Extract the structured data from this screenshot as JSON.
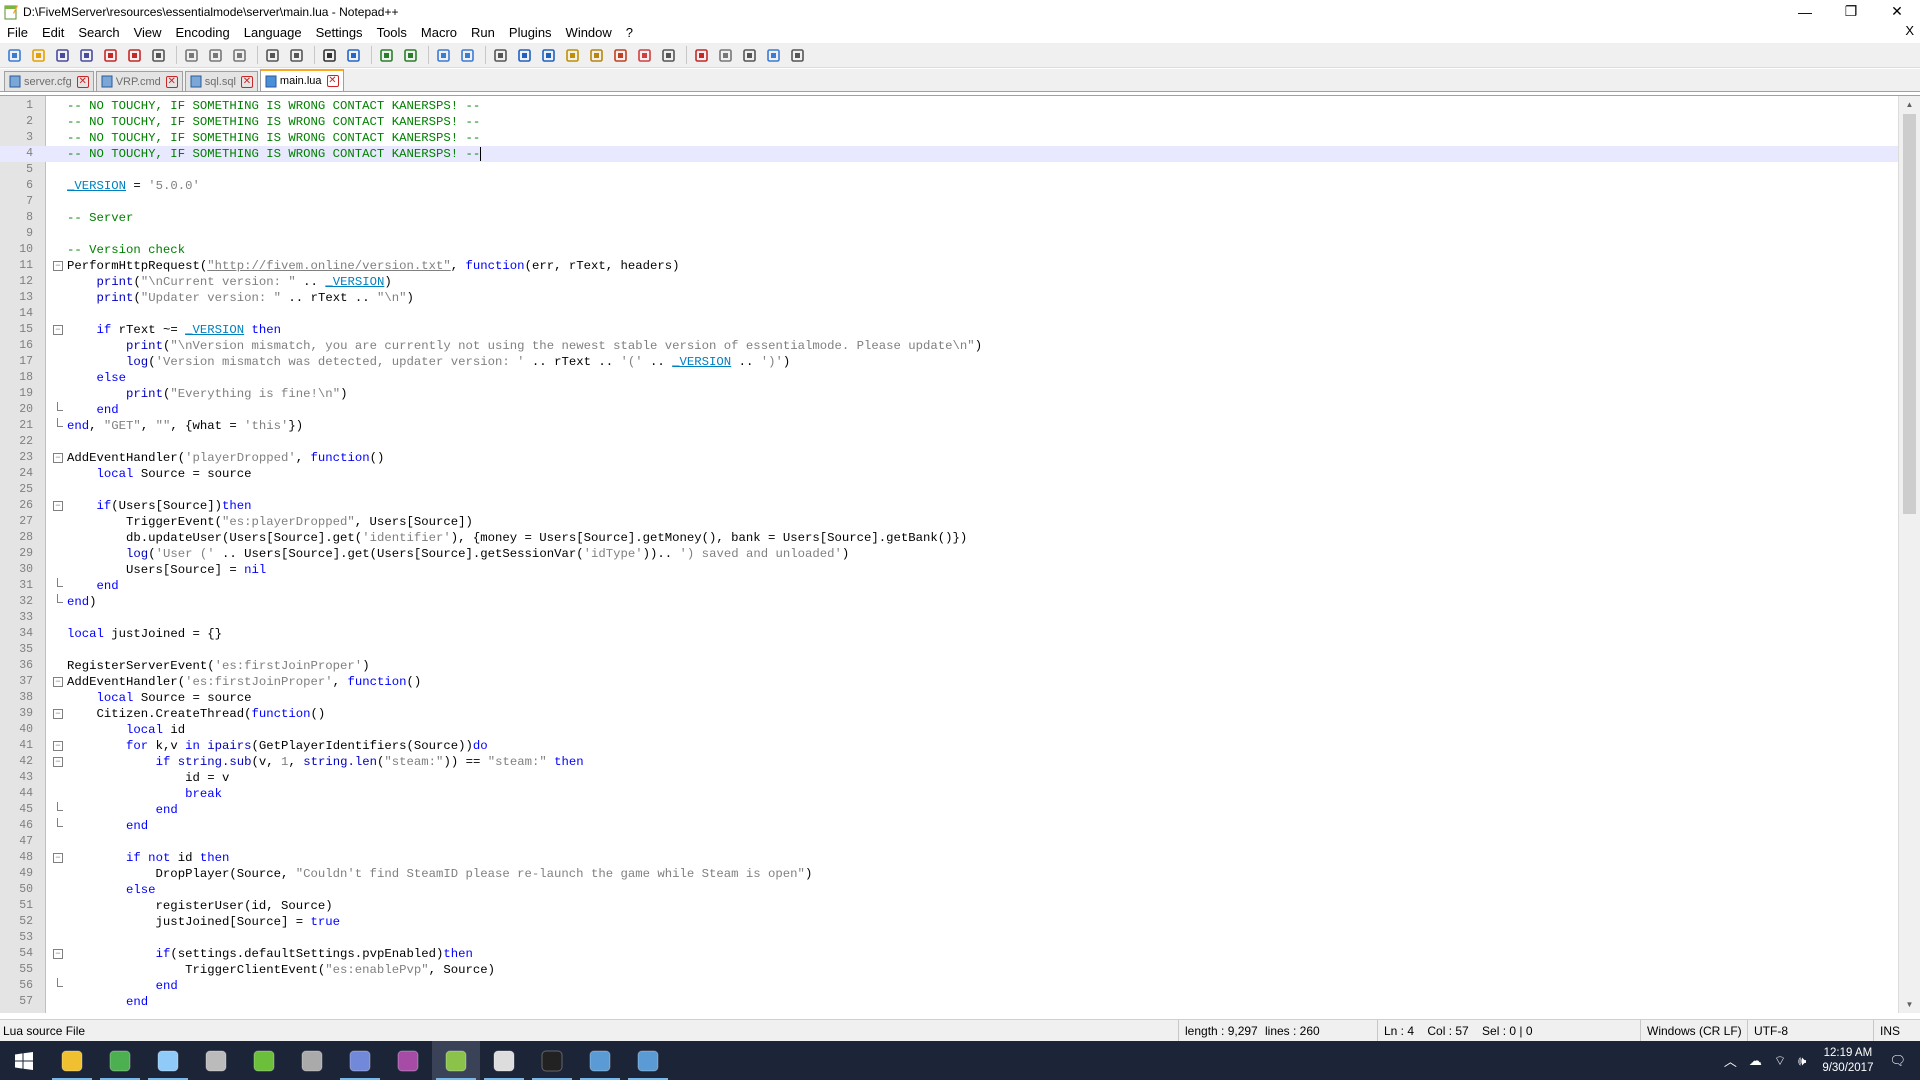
{
  "window": {
    "title": "D:\\FiveMServer\\resources\\essentialmode\\server\\main.lua - Notepad++",
    "minimize": "—",
    "maximize": "❐",
    "close": "✕"
  },
  "menu": {
    "items": [
      "File",
      "Edit",
      "Search",
      "View",
      "Encoding",
      "Language",
      "Settings",
      "Tools",
      "Macro",
      "Run",
      "Plugins",
      "Window",
      "?"
    ],
    "close_doc": "X"
  },
  "toolbar": {
    "icons": [
      "new-file-icon",
      "open-file-icon",
      "save-icon",
      "save-all-icon",
      "close-icon",
      "close-all-icon",
      "print-icon",
      "cut-icon",
      "copy-icon",
      "paste-icon",
      "undo-icon",
      "redo-icon",
      "find-icon",
      "replace-icon",
      "zoom-in-icon",
      "zoom-out-icon",
      "sync-vertical-icon",
      "sync-horizontal-icon",
      "word-wrap-icon",
      "show-all-chars-icon",
      "indent-guide-icon",
      "udl-icon",
      "doc-map-icon",
      "function-list-icon",
      "folder-as-workspace-icon",
      "monitoring-icon",
      "record-macro-icon",
      "stop-macro-icon",
      "play-macro-icon",
      "run-macro-multiple-icon",
      "save-macro-icon"
    ]
  },
  "tabs": [
    {
      "label": "server.cfg",
      "active": false
    },
    {
      "label": "VRP.cmd",
      "active": false
    },
    {
      "label": "sql.sql",
      "active": false
    },
    {
      "label": "main.lua",
      "active": true
    }
  ],
  "editor": {
    "current_line": 4,
    "lines": [
      {
        "n": "1",
        "fold": "",
        "html": "<span class='cm'>-- NO TOUCHY, IF SOMETHING IS WRONG CONTACT KANERSPS! --</span>"
      },
      {
        "n": "2",
        "fold": "",
        "html": "<span class='cm'>-- NO TOUCHY, IF SOMETHING IS WRONG CONTACT KANERSPS! --</span>"
      },
      {
        "n": "3",
        "fold": "",
        "html": "<span class='cm'>-- NO TOUCHY, IF SOMETHING IS WRONG CONTACT KANERSPS! --</span>"
      },
      {
        "n": "4",
        "fold": "",
        "html": "<span class='cm'>-- NO TOUCHY, IF SOMETHING IS WRONG CONTACT KANERSPS! --</span><span class='caret'></span>"
      },
      {
        "n": "5",
        "fold": "",
        "html": ""
      },
      {
        "n": "6",
        "fold": "",
        "html": "<span class='vr'>_VERSION</span> = <span class='st'>'5.0.0'</span>"
      },
      {
        "n": "7",
        "fold": "",
        "html": ""
      },
      {
        "n": "8",
        "fold": "",
        "html": "<span class='cm'>-- Server</span>"
      },
      {
        "n": "9",
        "fold": "",
        "html": ""
      },
      {
        "n": "10",
        "fold": "",
        "html": "<span class='cm'>-- Version check</span>"
      },
      {
        "n": "11",
        "fold": "minus",
        "html": "PerformHttpRequest(<span class='ul'>\"http://fivem.online/version.txt\"</span>, <span class='kw'>function</span>(err, rText, headers)"
      },
      {
        "n": "12",
        "fold": "",
        "html": "    <span class='fn'>print</span>(<span class='st'>\"\\nCurrent version: \"</span> .. <span class='vr'>_VERSION</span>)"
      },
      {
        "n": "13",
        "fold": "",
        "html": "    <span class='fn'>print</span>(<span class='st'>\"Updater version: \"</span> .. rText .. <span class='st'>\"\\n\"</span>)"
      },
      {
        "n": "14",
        "fold": "",
        "html": ""
      },
      {
        "n": "15",
        "fold": "minus",
        "html": "    <span class='kw'>if</span> rText ~= <span class='vr'>_VERSION</span> <span class='kw'>then</span>"
      },
      {
        "n": "16",
        "fold": "",
        "html": "        <span class='fn'>print</span>(<span class='st'>\"\\nVersion mismatch, you are currently not using the newest stable version of essentialmode. Please update\\n\"</span>)"
      },
      {
        "n": "17",
        "fold": "",
        "html": "        <span class='fn'>log</span>(<span class='st'>'Version mismatch was detected, updater version: '</span> .. rText .. <span class='st'>'('</span> .. <span class='vr'>_VERSION</span> .. <span class='st'>')'</span>)"
      },
      {
        "n": "18",
        "fold": "",
        "html": "    <span class='kw'>else</span>"
      },
      {
        "n": "19",
        "fold": "",
        "html": "        <span class='fn'>print</span>(<span class='st'>\"Everything is fine!\\n\"</span>)"
      },
      {
        "n": "20",
        "fold": "end",
        "html": "    <span class='kw'>end</span>"
      },
      {
        "n": "21",
        "fold": "end",
        "html": "<span class='kw'>end</span>, <span class='st'>\"GET\"</span>, <span class='st'>\"\"</span>, {what = <span class='st'>'this'</span>})"
      },
      {
        "n": "22",
        "fold": "",
        "html": ""
      },
      {
        "n": "23",
        "fold": "minus",
        "html": "AddEventHandler(<span class='st'>'playerDropped'</span>, <span class='kw'>function</span>()"
      },
      {
        "n": "24",
        "fold": "",
        "html": "    <span class='kw'>local</span> Source = source"
      },
      {
        "n": "25",
        "fold": "",
        "html": ""
      },
      {
        "n": "26",
        "fold": "minus",
        "html": "    <span class='kw'>if</span>(Users[Source])<span class='kw'>then</span>"
      },
      {
        "n": "27",
        "fold": "",
        "html": "        TriggerEvent(<span class='st'>\"es:playerDropped\"</span>, Users[Source])"
      },
      {
        "n": "28",
        "fold": "",
        "html": "        db.updateUser(Users[Source].get(<span class='st'>'identifier'</span>), {money = Users[Source].getMoney(), bank = Users[Source].getBank()})"
      },
      {
        "n": "29",
        "fold": "",
        "html": "        <span class='fn'>log</span>(<span class='st'>'User ('</span> .. Users[Source].get(Users[Source].getSessionVar(<span class='st'>'idType'</span>)).. <span class='st'>') saved and unloaded'</span>)"
      },
      {
        "n": "30",
        "fold": "",
        "html": "        Users[Source] = <span class='kw'>nil</span>"
      },
      {
        "n": "31",
        "fold": "end",
        "html": "    <span class='kw'>end</span>"
      },
      {
        "n": "32",
        "fold": "end",
        "html": "<span class='kw'>end</span>)"
      },
      {
        "n": "33",
        "fold": "",
        "html": ""
      },
      {
        "n": "34",
        "fold": "",
        "html": "<span class='kw'>local</span> justJoined = {}"
      },
      {
        "n": "35",
        "fold": "",
        "html": ""
      },
      {
        "n": "36",
        "fold": "",
        "html": "RegisterServerEvent(<span class='st'>'es:firstJoinProper'</span>)"
      },
      {
        "n": "37",
        "fold": "minus",
        "html": "AddEventHandler(<span class='st'>'es:firstJoinProper'</span>, <span class='kw'>function</span>()"
      },
      {
        "n": "38",
        "fold": "",
        "html": "    <span class='kw'>local</span> Source = source"
      },
      {
        "n": "39",
        "fold": "minus",
        "html": "    Citizen.CreateThread(<span class='kw'>function</span>()"
      },
      {
        "n": "40",
        "fold": "",
        "html": "        <span class='kw'>local</span> id"
      },
      {
        "n": "41",
        "fold": "minus",
        "html": "        <span class='kw'>for</span> k,v <span class='kw'>in</span> <span class='fn'>ipairs</span>(GetPlayerIdentifiers(Source))<span class='kw'>do</span>"
      },
      {
        "n": "42",
        "fold": "minus",
        "html": "            <span class='kw'>if</span> <span class='fn'>string.sub</span>(v, <span class='st'>1</span>, <span class='fn'>string.len</span>(<span class='st'>\"steam:\"</span>)) == <span class='st'>\"steam:\"</span> <span class='kw'>then</span>"
      },
      {
        "n": "43",
        "fold": "",
        "html": "                id = v"
      },
      {
        "n": "44",
        "fold": "",
        "html": "                <span class='kw'>break</span>"
      },
      {
        "n": "45",
        "fold": "end",
        "html": "            <span class='kw'>end</span>"
      },
      {
        "n": "46",
        "fold": "end",
        "html": "        <span class='kw'>end</span>"
      },
      {
        "n": "47",
        "fold": "",
        "html": ""
      },
      {
        "n": "48",
        "fold": "minus",
        "html": "        <span class='kw'>if not</span> id <span class='kw'>then</span>"
      },
      {
        "n": "49",
        "fold": "",
        "html": "            DropPlayer(Source, <span class='st'>\"Couldn't find SteamID please re-launch the game while Steam is open\"</span>)"
      },
      {
        "n": "50",
        "fold": "",
        "html": "        <span class='kw'>else</span>"
      },
      {
        "n": "51",
        "fold": "",
        "html": "            registerUser(id, Source)"
      },
      {
        "n": "52",
        "fold": "",
        "html": "            justJoined[Source] = <span class='kw'>true</span>"
      },
      {
        "n": "53",
        "fold": "",
        "html": ""
      },
      {
        "n": "54",
        "fold": "minus",
        "html": "            <span class='kw'>if</span>(settings.defaultSettings.pvpEnabled)<span class='kw'>then</span>"
      },
      {
        "n": "55",
        "fold": "",
        "html": "                TriggerClientEvent(<span class='st'>\"es:enablePvp\"</span>, Source)"
      },
      {
        "n": "56",
        "fold": "end",
        "html": "            <span class='kw'>end</span>"
      },
      {
        "n": "57",
        "fold": "",
        "html": "        <span class='kw'>end</span>"
      }
    ]
  },
  "status": {
    "file_type": "Lua source File",
    "length": "length : 9,297",
    "lines": "lines : 260",
    "position": "Ln : 4    Col : 57    Sel : 0 | 0",
    "eol": "Windows (CR LF)",
    "encoding": "UTF-8",
    "mode": "INS"
  },
  "taskbar": {
    "apps": [
      "file-explorer",
      "chrome",
      "steam",
      "obs",
      "utorrent",
      "fivem",
      "discord",
      "winrar",
      "notepad-plus-plus",
      "settings-gear",
      "command-prompt",
      "mysql-workbench",
      "mysql-workbench-2"
    ],
    "active_app": "notepad-plus-plus",
    "time": "12:19 AM",
    "date": "9/30/2017"
  },
  "colors": {
    "comment": "#008000",
    "keyword": "#0000ff",
    "string": "#808080",
    "current_line": "#e8e8ff",
    "taskbar": "#1c2538"
  }
}
